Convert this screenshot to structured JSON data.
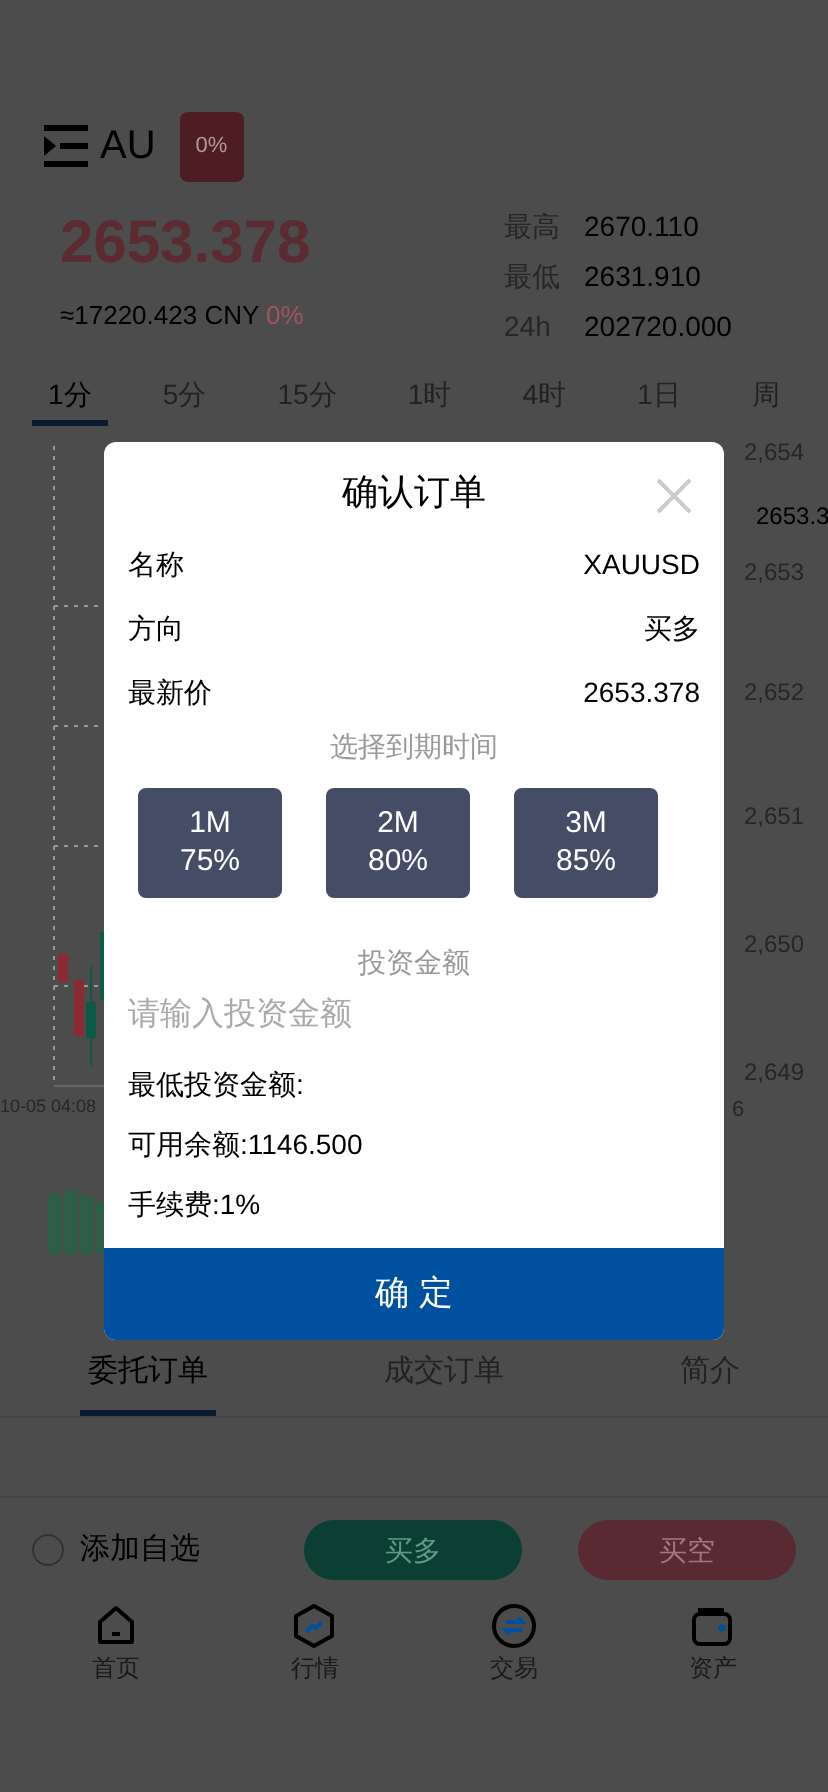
{
  "header": {
    "symbol": "AU",
    "change_badge": "0%"
  },
  "price": "2653.378",
  "cny": "≈17220.423 CNY",
  "cny_change": "0%",
  "stats": [
    {
      "label": "最高",
      "value": "2670.110"
    },
    {
      "label": "最低",
      "value": "2631.910"
    },
    {
      "label": "24h",
      "value": "202720.000"
    }
  ],
  "intervals": [
    {
      "label": "1分",
      "selected": true
    },
    {
      "label": "5分",
      "selected": false
    },
    {
      "label": "15分",
      "selected": false
    },
    {
      "label": "1时",
      "selected": false
    },
    {
      "label": "4时",
      "selected": false
    },
    {
      "label": "1日",
      "selected": false
    },
    {
      "label": "周",
      "selected": false
    }
  ],
  "chart": {
    "y_labels": [
      "2,654",
      "2,653",
      "2,652",
      "2,651",
      "2,650",
      "2,649"
    ],
    "price_tag": "2653.3",
    "x_labels": [
      "10-05 04:08",
      "6"
    ]
  },
  "modal": {
    "title": "确认订单",
    "rows": [
      {
        "label": "名称",
        "value": "XAUUSD"
      },
      {
        "label": "方向",
        "value": "买多"
      },
      {
        "label": "最新价",
        "value": "2653.378"
      }
    ],
    "expiry_label": "选择到期时间",
    "durations": [
      {
        "label": "1M",
        "rate": "75%",
        "selected": false
      },
      {
        "label": "2M",
        "rate": "80%",
        "selected": false
      },
      {
        "label": "3M",
        "rate": "85%",
        "selected": false
      }
    ],
    "amount_label": "投资金额",
    "amount_placeholder": "请输入投资金额",
    "info": [
      "最低投资金额:",
      "可用余额:1146.500",
      "手续费:1%"
    ],
    "confirm": "确 定"
  },
  "order_tabs": [
    {
      "label": "委托订单",
      "selected": true
    },
    {
      "label": "成交订单",
      "selected": false
    },
    {
      "label": "简介",
      "selected": false
    }
  ],
  "favorite": {
    "label": "添加自选",
    "checked": false
  },
  "buy": "买多",
  "sell": "买空",
  "nav": [
    {
      "label": "首页",
      "kind": "home"
    },
    {
      "label": "行情",
      "kind": "market"
    },
    {
      "label": "交易",
      "kind": "trade"
    },
    {
      "label": "资产",
      "kind": "wallet"
    }
  ]
}
